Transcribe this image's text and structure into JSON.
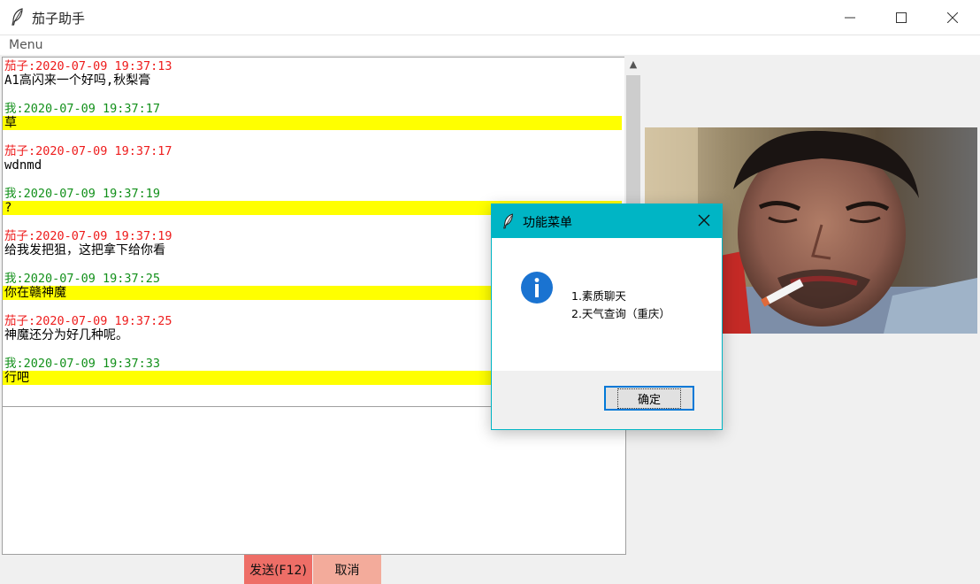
{
  "window": {
    "title": "茄子助手"
  },
  "menubar": {
    "menu_label": "Menu"
  },
  "messages": [
    {
      "sender": "other",
      "header": "茄子:2020-07-09 19:37:13",
      "text": "A1高闪来一个好吗,秋梨膏"
    },
    {
      "sender": "me",
      "header": "我:2020-07-09 19:37:17",
      "text": "草"
    },
    {
      "sender": "other",
      "header": "茄子:2020-07-09 19:37:17",
      "text": "wdnmd"
    },
    {
      "sender": "me",
      "header": "我:2020-07-09 19:37:19",
      "text": "?"
    },
    {
      "sender": "other",
      "header": "茄子:2020-07-09 19:37:19",
      "text": "给我发把狙，这把拿下给你看"
    },
    {
      "sender": "me",
      "header": "我:2020-07-09 19:37:25",
      "text": "你在赣神魔"
    },
    {
      "sender": "other",
      "header": "茄子:2020-07-09 19:37:25",
      "text": "神魔还分为好几种呢。"
    },
    {
      "sender": "me",
      "header": "我:2020-07-09 19:37:33",
      "text": "行吧"
    }
  ],
  "input": {
    "value": ""
  },
  "buttons": {
    "send_label": "发送(F12)",
    "cancel_label": "取消"
  },
  "dialog": {
    "title": "功能菜单",
    "lines": [
      "1.素质聊天",
      "2.天气查询（重庆）"
    ],
    "ok_label": "确定"
  },
  "colors": {
    "other_sender": "#ee1c1c",
    "me_sender": "#12901a",
    "me_highlight": "#ffff00",
    "send_button": "#ee6e67",
    "cancel_button": "#f3ab9b",
    "dialog_header": "#00b5c5"
  },
  "icons": {
    "app": "feather-icon",
    "dialog_info": "info-icon",
    "minimize": "minimize-icon",
    "maximize": "maximize-icon",
    "close": "close-icon"
  }
}
